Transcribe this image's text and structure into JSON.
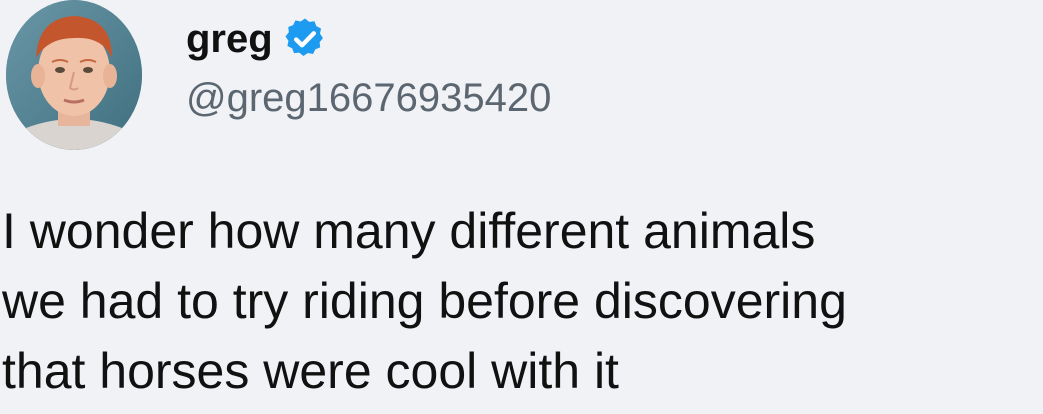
{
  "tweet": {
    "author": {
      "display_name": "greg",
      "handle": "@greg16676935420",
      "verified": true,
      "verified_color": "#1d9bf0"
    },
    "text_lines": [
      "I wonder how many different animals",
      "we had to try riding before discovering",
      "that horses were cool with it"
    ]
  },
  "icons": {
    "verified": "verified-badge-icon",
    "avatar": "profile-photo"
  }
}
